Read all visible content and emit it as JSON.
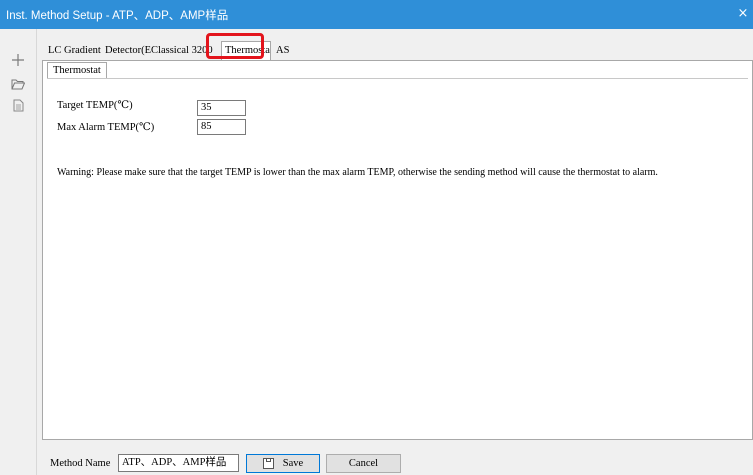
{
  "window": {
    "title": "Inst. Method Setup - ATP、ADP、AMP样品",
    "close_glyph": "×"
  },
  "left_toolbar": [
    {
      "name": "add-icon",
      "glyph": "+"
    },
    {
      "name": "open-folder-icon",
      "glyph": "🗁"
    },
    {
      "name": "save-as-icon",
      "glyph": "🗎"
    }
  ],
  "tabs": [
    {
      "label": "LC Gradient",
      "active": false
    },
    {
      "label": "Detector(EClassical 3200",
      "active": false
    },
    {
      "label": "Thermosta",
      "active": true
    },
    {
      "label": "AS",
      "active": false
    }
  ],
  "subtab": {
    "label": "Thermostat"
  },
  "thermostat": {
    "target_label": "Target TEMP(℃)",
    "target_value": "35",
    "max_label": "Max Alarm TEMP(℃)",
    "max_value": "85",
    "warning": "Warning: Please make sure that the target TEMP is lower than the max alarm TEMP, otherwise the sending method will cause the thermostat to alarm."
  },
  "bottom": {
    "method_name_label": "Method Name",
    "method_name_value": "ATP、ADP、AMP样品",
    "save_label": "Save",
    "cancel_label": "Cancel"
  },
  "colors": {
    "title_bar": "#2f8fd8",
    "highlight": "#e3141c"
  }
}
